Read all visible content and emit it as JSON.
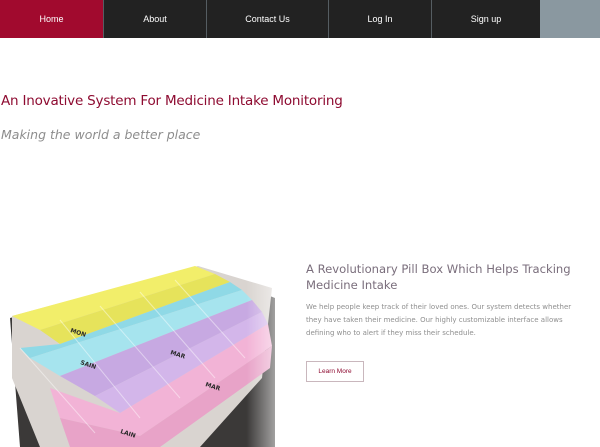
{
  "nav": {
    "items": [
      {
        "label": "Home"
      },
      {
        "label": "About"
      },
      {
        "label": "Contact Us"
      },
      {
        "label": "Log In"
      },
      {
        "label": "Sign up"
      }
    ]
  },
  "hero": {
    "title": "An Inovative System For Medicine Intake Monitoring",
    "subtitle": "Making the world a better place"
  },
  "feature": {
    "title": "A Revolutionary Pill Box Which Helps Tracking Medicine Intake",
    "description": "We help people keep track of their loved ones. Our system detects whether they have taken their medicine. Our highly customizable interface allows defining who to alert if they miss their schedule.",
    "button_label": "Learn More"
  },
  "colors": {
    "accent": "#a10a2e",
    "nav_bg": "#222222",
    "title": "#8e0b31"
  }
}
